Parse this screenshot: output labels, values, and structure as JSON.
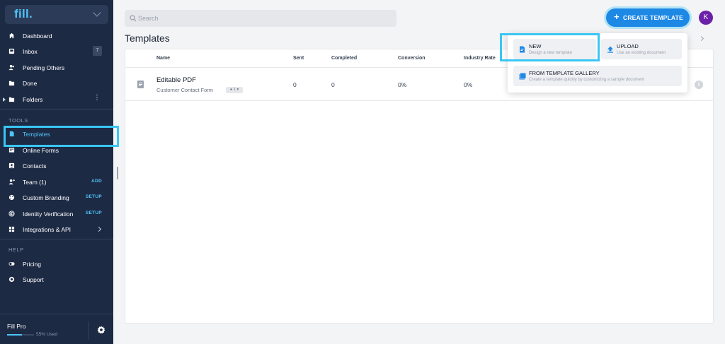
{
  "sidebar": {
    "brand": "fill.",
    "nav": [
      {
        "label": "Dashboard",
        "icon": "home-icon"
      },
      {
        "label": "Inbox",
        "icon": "inbox-icon",
        "badge": "7"
      },
      {
        "label": "Pending Others",
        "icon": "users-icon"
      },
      {
        "label": "Done",
        "icon": "folder-check-icon"
      },
      {
        "label": "Folders",
        "icon": "folder-icon"
      }
    ],
    "tools_heading": "TOOLS",
    "tools": [
      {
        "label": "Templates",
        "icon": "template-icon"
      },
      {
        "label": "Online Forms",
        "icon": "form-icon"
      },
      {
        "label": "Contacts",
        "icon": "contacts-icon"
      },
      {
        "label": "Team (1)",
        "icon": "team-icon",
        "action": "ADD"
      },
      {
        "label": "Custom Branding",
        "icon": "palette-icon",
        "action": "SETUP"
      },
      {
        "label": "Identity Verification",
        "icon": "fingerprint-icon",
        "action": "SETUP"
      },
      {
        "label": "Integrations & API",
        "icon": "grid-icon"
      }
    ],
    "help_heading": "HELP",
    "help": [
      {
        "label": "Pricing",
        "icon": "toggle-icon"
      },
      {
        "label": "Support",
        "icon": "lifebuoy-icon"
      }
    ],
    "footer": {
      "plan": "Fill Pro",
      "usage": "55% Used",
      "usage_fraction": 0.55
    }
  },
  "topbar": {
    "search_placeholder": "Search",
    "search_value": "",
    "create_button": "CREATE TEMPLATE",
    "avatar_initial": "K"
  },
  "page": {
    "title": "Templates"
  },
  "table": {
    "columns": [
      "Name",
      "Sent",
      "Completed",
      "Conversion",
      "Industry Rate"
    ],
    "rows": [
      {
        "title": "Editable PDF",
        "subtitle": "Customer Contact Form",
        "pill": "1",
        "sent": "0",
        "completed": "0",
        "conversion": "0%",
        "industry_rate": "0%"
      }
    ]
  },
  "menu": {
    "new": {
      "title": "NEW",
      "desc": "Design a new template"
    },
    "upload": {
      "title": "UPLOAD",
      "desc": "Use an existing document"
    },
    "gallery": {
      "title": "FROM TEMPLATE GALLERY",
      "desc": "Create a template quickly by customizing a sample document"
    }
  },
  "colors": {
    "sidebar_bg": "#1d2a44",
    "accent": "#4fc3f7",
    "primary_button": "#1e88e5",
    "avatar": "#6b21a8",
    "highlight": "#38c6f4"
  }
}
